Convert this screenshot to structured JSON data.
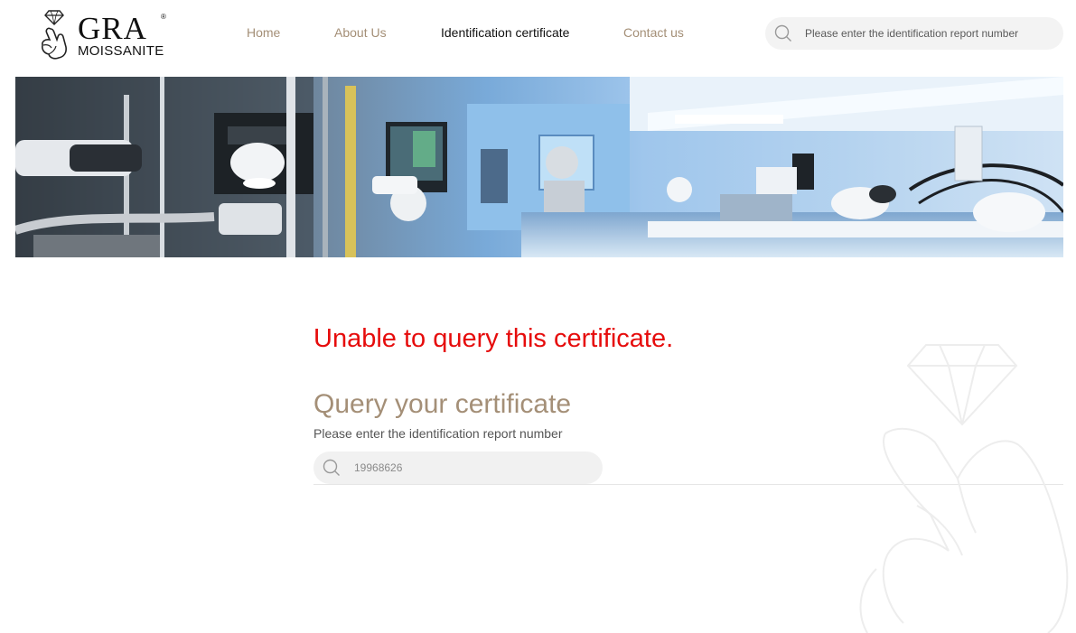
{
  "brand": {
    "name": "GRA",
    "sub": "MOISSANITE",
    "reg": "®"
  },
  "nav": [
    {
      "label": "Home",
      "active": false
    },
    {
      "label": "About Us",
      "active": false
    },
    {
      "label": "Identification certificate",
      "active": true
    },
    {
      "label": "Contact us",
      "active": false
    }
  ],
  "header_search": {
    "placeholder": "Please enter the identification report number",
    "icon": "search-icon"
  },
  "banner": {
    "icon": "laboratory-photo"
  },
  "main": {
    "error": "Unable to query this certificate.",
    "title": "Query your certificate",
    "hint": "Please enter the identification report number",
    "search": {
      "value": "19968626",
      "icon": "search-icon"
    }
  },
  "colors": {
    "accent": "#a48f77",
    "error": "#e60c0c",
    "search_bg": "#f3f3f3"
  }
}
